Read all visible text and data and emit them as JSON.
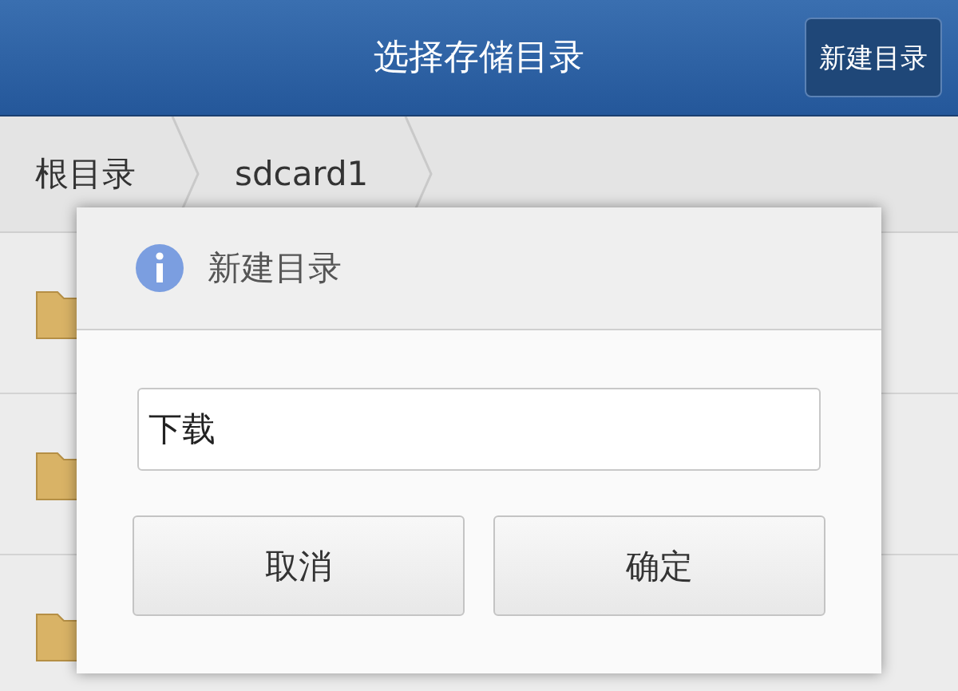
{
  "header": {
    "title": "选择存储目录",
    "action": "新建目录"
  },
  "breadcrumb": [
    {
      "label": "根目录"
    },
    {
      "label": "sdcard1"
    }
  ],
  "folders": [
    {
      "kind": "folder"
    },
    {
      "kind": "folder"
    },
    {
      "kind": "folder"
    }
  ],
  "dialog": {
    "title": "新建目录",
    "input": {
      "value": "下载"
    },
    "buttons": [
      "取消",
      "确定"
    ]
  }
}
